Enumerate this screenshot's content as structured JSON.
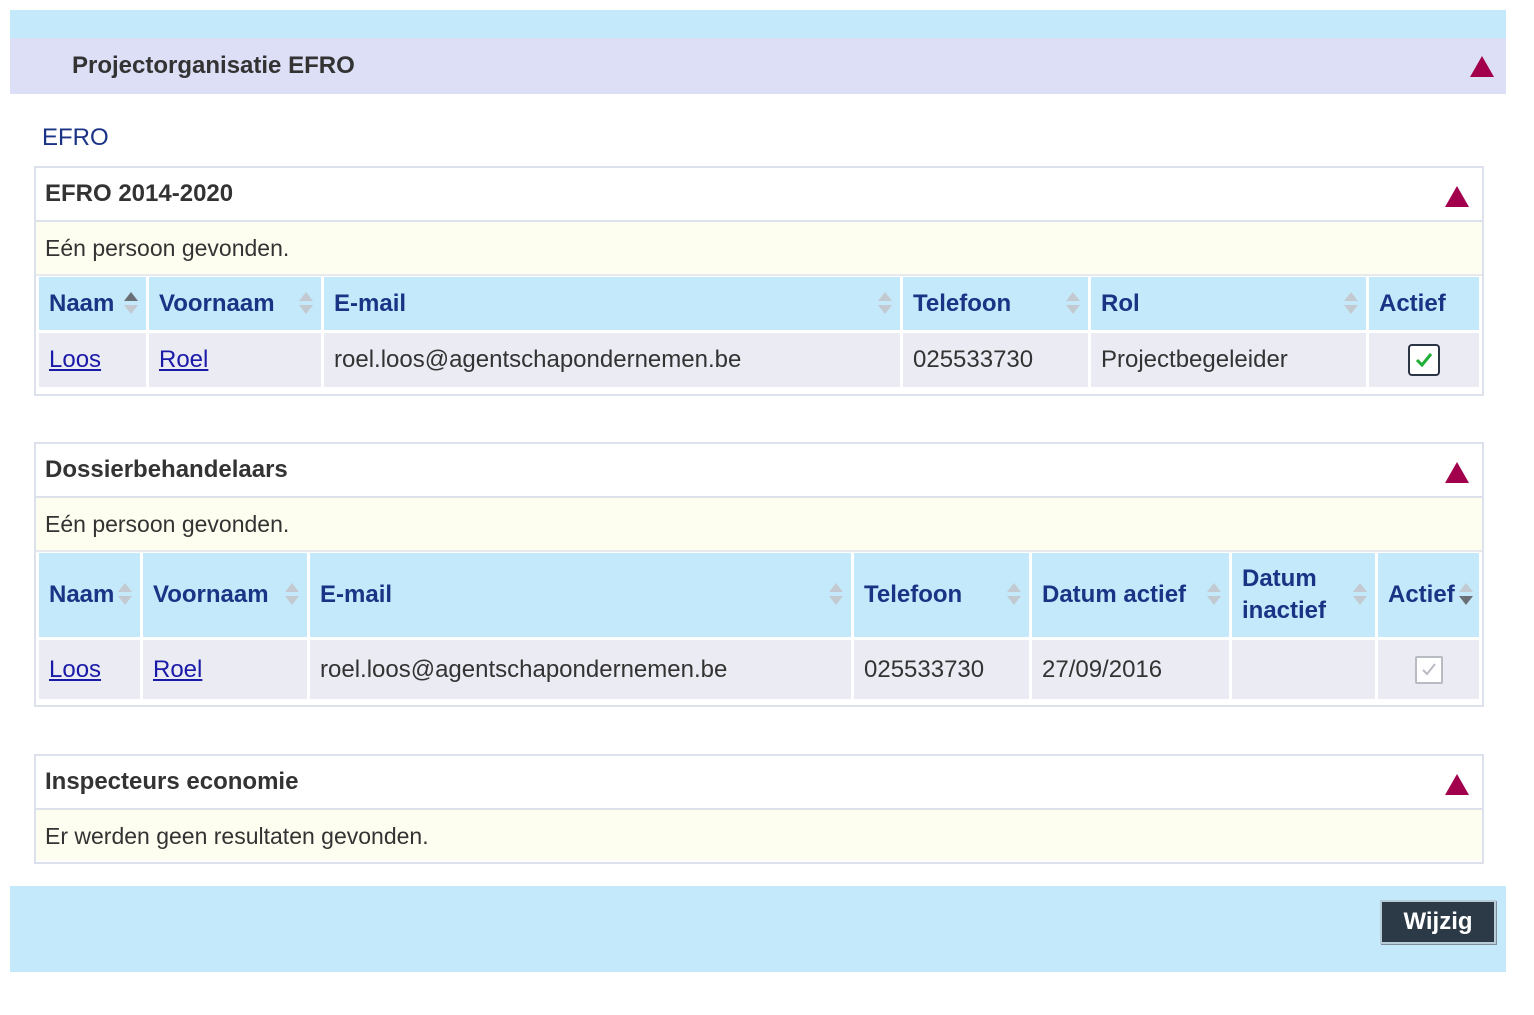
{
  "panel": {
    "title": "Projectorganisatie EFRO"
  },
  "program_label": "EFRO",
  "sections": [
    {
      "title": "EFRO 2014-2020",
      "message": "Eén persoon gevonden.",
      "columns": [
        "Naam",
        "Voornaam",
        "E-mail",
        "Telefoon",
        "Rol",
        "Actief"
      ],
      "rows": [
        {
          "naam": "Loos",
          "voornaam": "Roel",
          "email": "roel.loos@agentschapondernemen.be",
          "telefoon": "025533730",
          "rol": "Projectbegeleider",
          "actief": true
        }
      ]
    },
    {
      "title": "Dossierbehandelaars",
      "message": "Eén persoon gevonden.",
      "columns": [
        "Naam",
        "Voornaam",
        "E-mail",
        "Telefoon",
        "Datum actief",
        "Datum inactief",
        "Actief"
      ],
      "rows": [
        {
          "naam": "Loos",
          "voornaam": "Roel",
          "email": "roel.loos@agentschapondernemen.be",
          "telefoon": "025533730",
          "datum_actief": "27/09/2016",
          "datum_inactief": "",
          "actief": true
        }
      ]
    },
    {
      "title": "Inspecteurs economie",
      "message": "Er werden geen resultaten gevonden."
    }
  ],
  "actions": {
    "edit_label": "Wijzig"
  },
  "colors": {
    "accent": "#a2004d",
    "header_bg": "#c4e9fb",
    "panel_header_bg": "#dcdff5",
    "link": "#1a1aa8"
  }
}
